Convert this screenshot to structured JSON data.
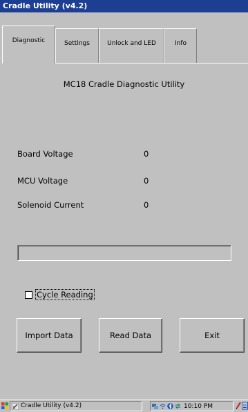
{
  "window": {
    "title": "Cradle Utility (v4.2)"
  },
  "tabs": [
    {
      "label": "Diagnostic",
      "active": true
    },
    {
      "label": "Settings",
      "active": false
    },
    {
      "label": "Unlock and LED",
      "active": false
    },
    {
      "label": "Info",
      "active": false
    }
  ],
  "main": {
    "title": "MC18 Cradle Diagnostic Utility",
    "readings": [
      {
        "label": "Board Voltage",
        "value": "0"
      },
      {
        "label": "MCU Voltage",
        "value": "0"
      },
      {
        "label": "Solenoid Current",
        "value": "0"
      }
    ],
    "progress": 0,
    "cycle_reading": {
      "label": "Cycle Reading",
      "checked": false
    },
    "buttons": {
      "import": "Import Data",
      "read": "Read Data",
      "exit": "Exit"
    }
  },
  "taskbar": {
    "task_label": "Cradle Utility (v4.2)",
    "clock": "10:10 PM"
  },
  "colors": {
    "titlebar": "#1c3f94",
    "face": "#c0c0c0"
  }
}
